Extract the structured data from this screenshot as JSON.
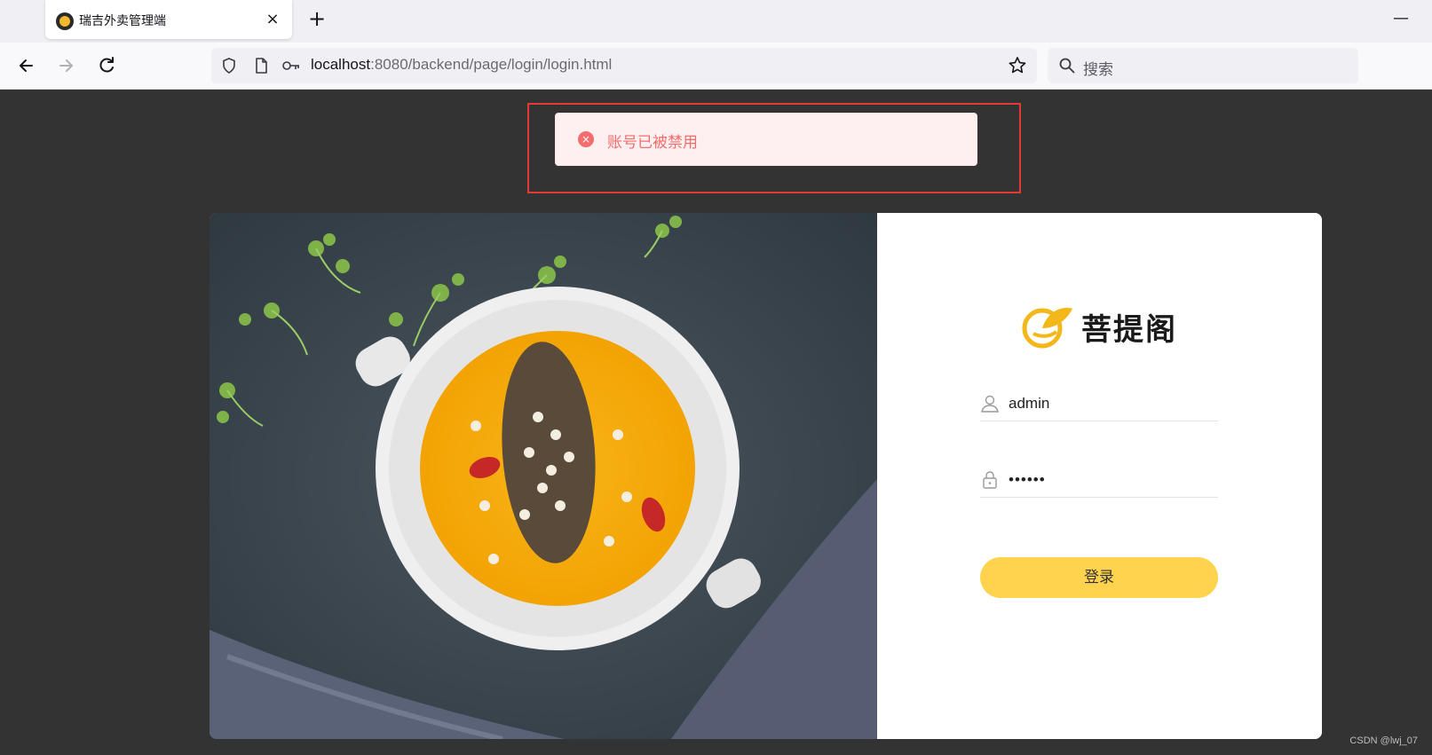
{
  "browser": {
    "tab_title": "瑞吉外卖管理端",
    "tab_close": "×",
    "new_tab": "+",
    "minimize": "—",
    "url_host": "localhost",
    "url_rest": ":8080/backend/page/login/login.html",
    "search_placeholder": "搜索"
  },
  "alert": {
    "message": "账号已被禁用",
    "icon": "error-icon",
    "icon_glyph": "×",
    "color": "#f56c6c"
  },
  "login": {
    "brand": "菩提阁",
    "username": "admin",
    "password_mask": "••••••",
    "submit_label": "登录",
    "button_color": "#ffd34e"
  },
  "watermark": "CSDN @lwj_07"
}
